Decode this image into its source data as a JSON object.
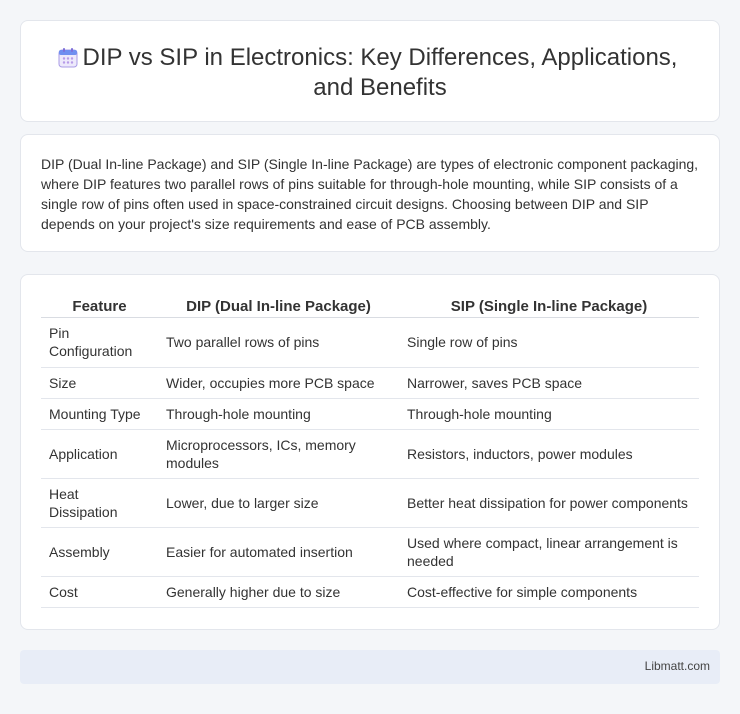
{
  "header": {
    "title_line1": "DIP vs SIP in Electronics: Key Differences, Applications,",
    "title_line2": "and Benefits",
    "icon": "calendar-icon"
  },
  "intro": {
    "text": "DIP (Dual In-line Package) and SIP (Single In-line Package) are types of electronic component packaging, where DIP features two parallel rows of pins suitable for through-hole mounting, while SIP consists of a single row of pins often used in space-constrained circuit designs. Choosing between DIP and SIP depends on your project's size requirements and ease of PCB assembly."
  },
  "table": {
    "headers": [
      "Feature",
      "DIP (Dual In-line Package)",
      "SIP (Single In-line Package)"
    ],
    "rows": [
      [
        "Pin Configuration",
        "Two parallel rows of pins",
        "Single row of pins"
      ],
      [
        "Size",
        "Wider, occupies more PCB space",
        "Narrower, saves PCB space"
      ],
      [
        "Mounting Type",
        "Through-hole mounting",
        "Through-hole mounting"
      ],
      [
        "Application",
        "Microprocessors, ICs, memory modules",
        "Resistors, inductors, power modules"
      ],
      [
        "Heat Dissipation",
        "Lower, due to larger size",
        "Better heat dissipation for power components"
      ],
      [
        "Assembly",
        "Easier for automated insertion",
        "Used where compact, linear arrangement is needed"
      ],
      [
        "Cost",
        "Generally higher due to size",
        "Cost-effective for simple components"
      ]
    ]
  },
  "footer": {
    "text": "Libmatt.com"
  }
}
